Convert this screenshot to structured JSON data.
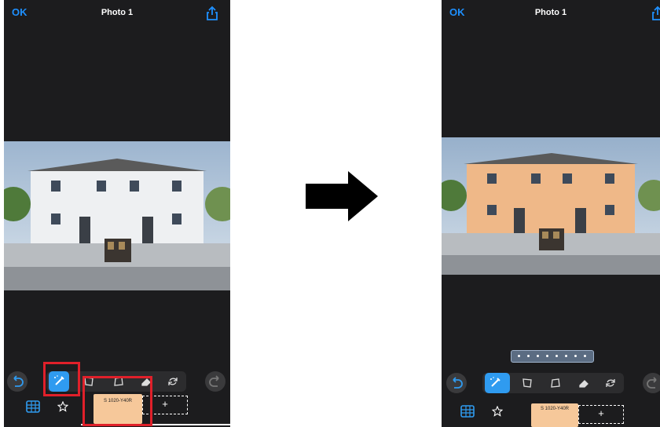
{
  "left_screen": {
    "ok_label": "OK",
    "title": "Photo 1",
    "color_swatch": "S 1020-Y40R",
    "add_label": "+"
  },
  "right_screen": {
    "ok_label": "OK",
    "title": "Photo 1",
    "color_swatch": "S 1020-Y40R",
    "add_label": "+"
  },
  "icons": [
    "undo-icon",
    "magic-brush-icon",
    "crop-icon",
    "perspective-icon",
    "eraser-icon",
    "reset-icon",
    "redo-icon",
    "color-grid-icon",
    "favorite-star-icon",
    "share-icon",
    "arrow-right-icon"
  ],
  "colors": {
    "accent": "#2f9bf0",
    "swatch": "#f6c89a",
    "highlight": "#e0202a"
  }
}
